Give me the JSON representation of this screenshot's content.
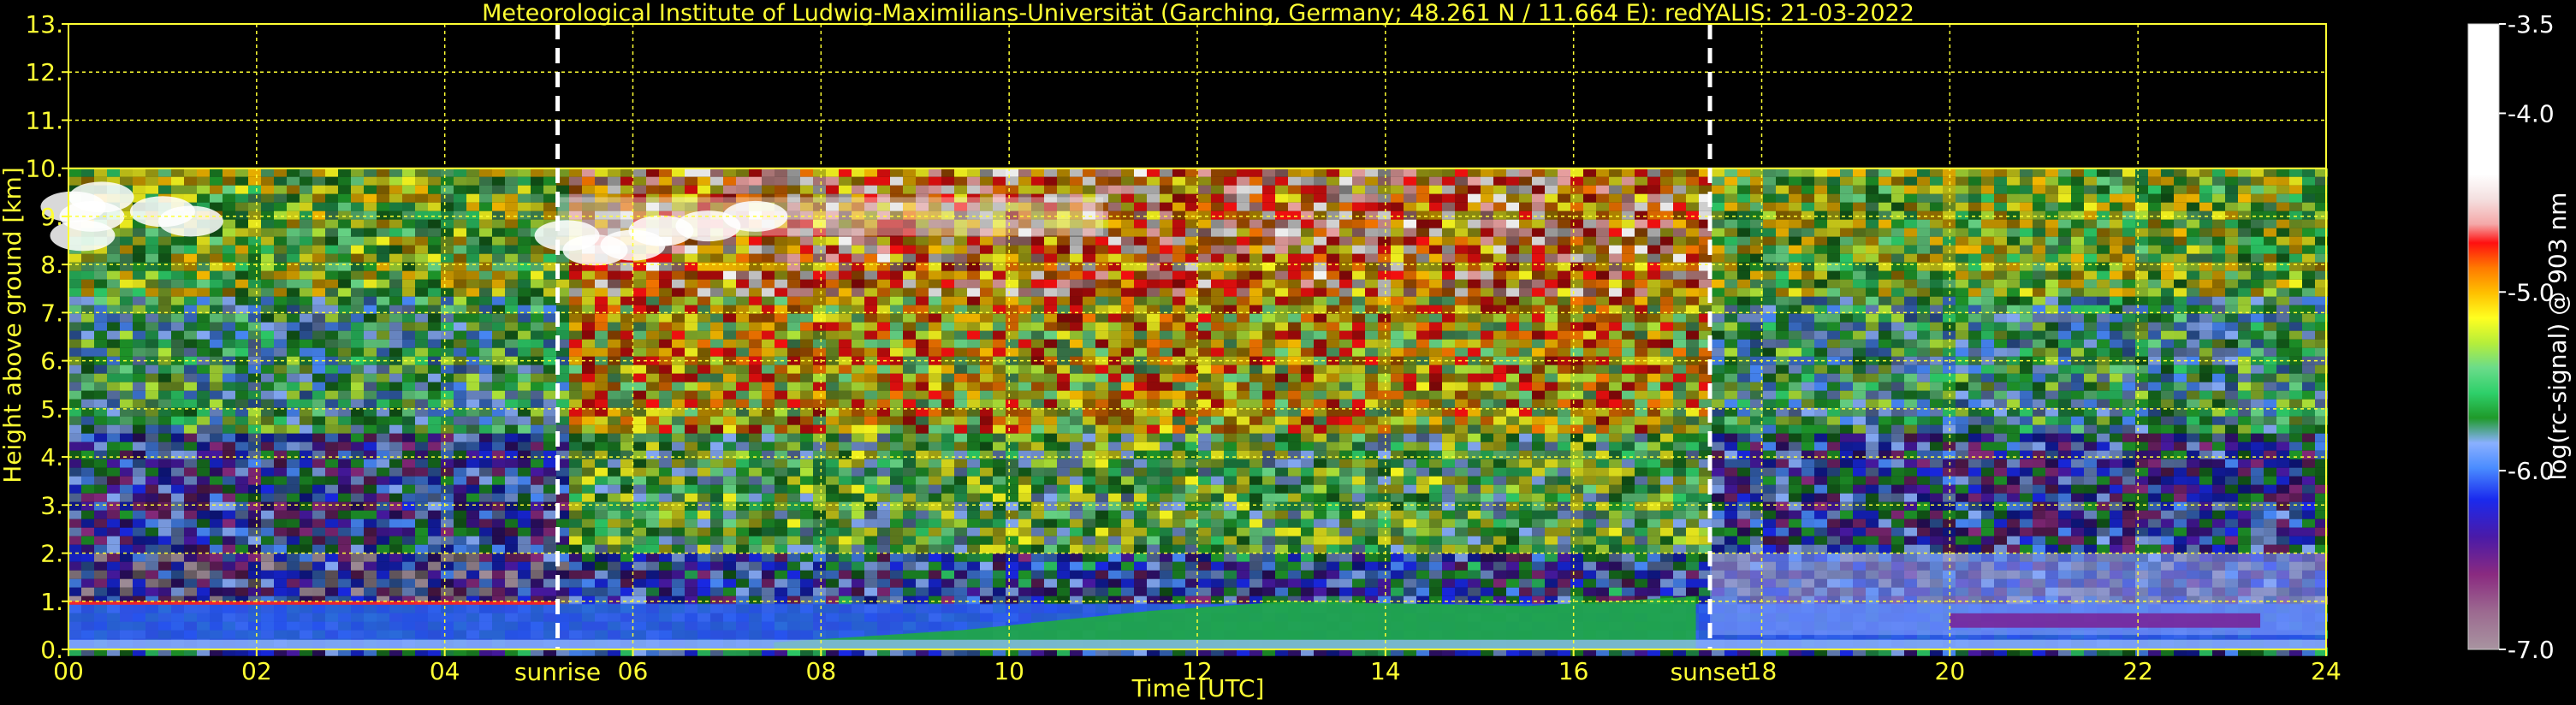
{
  "chart_data": {
    "type": "heatmap",
    "title": "Meteorological Institute of Ludwig-Maximilians-Universität (Garching, Germany; 48.261 N / 11.664 E):    redYALIS: 21-03-2022",
    "xlabel": "Time [UTC]",
    "ylabel": "Height above ground [km]",
    "xlim": [
      0,
      24
    ],
    "ylim": [
      0,
      13
    ],
    "x_ticks": [
      0,
      2,
      4,
      6,
      8,
      10,
      12,
      14,
      16,
      18,
      20,
      22,
      24
    ],
    "x_tick_labels": [
      "00",
      "02",
      "04",
      "06",
      "08",
      "10",
      "12",
      "14",
      "16",
      "18",
      "20",
      "22",
      "24"
    ],
    "y_ticks": [
      0,
      1,
      2,
      3,
      4,
      5,
      6,
      7,
      8,
      9,
      10,
      11,
      12,
      13
    ],
    "y_tick_labels": [
      "0.",
      "1.",
      "2.",
      "3.",
      "4.",
      "5.",
      "6.",
      "7.",
      "8.",
      "9.",
      "10.",
      "11.",
      "12.",
      "13."
    ],
    "grid": true,
    "data_ceiling_km": 10,
    "annotations": [
      {
        "label": "sunrise",
        "x": 5.2
      },
      {
        "label": "sunset",
        "x": 17.45
      }
    ],
    "colorbar": {
      "label": "log(rc-signal) @ 903 nm",
      "range": [
        -7.0,
        -3.5
      ],
      "ticks": [
        -3.5,
        -4.0,
        -5.0,
        -6.0,
        -7.0
      ],
      "tick_labels": [
        "-3.5",
        "-4.0",
        "-5.0",
        "-6.0",
        "-7.0"
      ]
    }
  },
  "colors": {
    "background": "#000000",
    "axis_text": "#ffff33",
    "grid": "#ffff33",
    "annotation_line": "#ffffff",
    "colorbar_text": "#ffffff"
  }
}
